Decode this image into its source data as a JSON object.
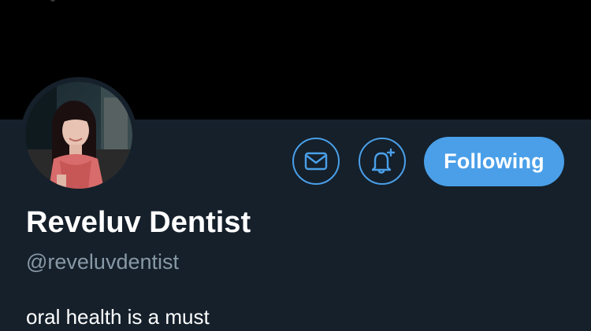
{
  "profile": {
    "display_name": "Reveluv Dentist",
    "handle": "@reveluvdentist",
    "bio": "oral health is a must",
    "avatar": "profile-avatar-photo"
  },
  "actions": {
    "message_icon": "envelope-icon",
    "notifications_icon": "bell-plus-icon",
    "follow_label": "Following"
  },
  "colors": {
    "background": "#15202b",
    "banner": "#000000",
    "accent": "#4a9fe8",
    "primary_text": "#ffffff",
    "secondary_text": "#8899a6"
  }
}
